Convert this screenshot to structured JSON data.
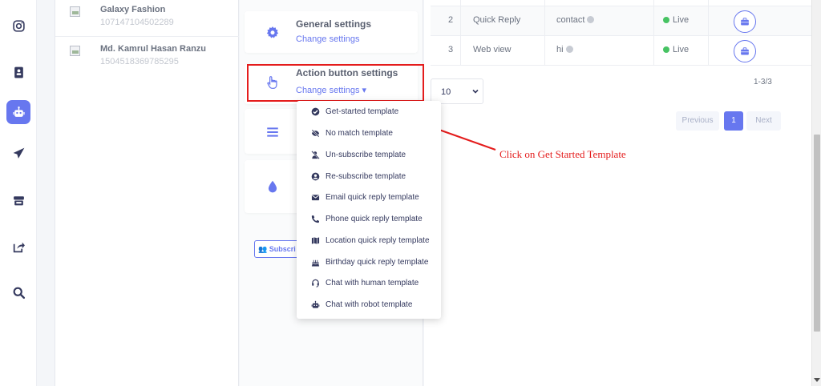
{
  "pages": [
    {
      "name": "Galaxy Fashion",
      "id": "107147104502289"
    },
    {
      "name": "Md. Kamrul Hasan Ranzu",
      "id": "1504518369785295"
    }
  ],
  "settings": {
    "general": {
      "title": "General settings",
      "link": "Change settings"
    },
    "action": {
      "title": "Action button settings",
      "link": "Change settings ▾"
    },
    "subscribers_button": "Subscri"
  },
  "menu": {
    "items": [
      {
        "label": "Get-started template",
        "icon": "check-circle-icon"
      },
      {
        "label": "No match template",
        "icon": "eye-slash-icon"
      },
      {
        "label": "Un-subscribe template",
        "icon": "user-slash-icon"
      },
      {
        "label": "Re-subscribe template",
        "icon": "user-circle-icon"
      },
      {
        "label": "Email quick reply template",
        "icon": "envelope-icon"
      },
      {
        "label": "Phone quick reply template",
        "icon": "phone-icon"
      },
      {
        "label": "Location quick reply template",
        "icon": "map-icon"
      },
      {
        "label": "Birthday quick reply template",
        "icon": "birthday-cake-icon"
      },
      {
        "label": "Chat with human template",
        "icon": "headset-icon"
      },
      {
        "label": "Chat with robot template",
        "icon": "robot-icon"
      }
    ]
  },
  "table": {
    "rows": [
      {
        "num": "2",
        "type": "Quick Reply",
        "keyword": "contact",
        "status": "Live"
      },
      {
        "num": "3",
        "type": "Web view",
        "keyword": "hi",
        "status": "Live"
      }
    ]
  },
  "pagination": {
    "per_page": "10",
    "count": "1-3/3",
    "previous": "Previous",
    "current": "1",
    "next": "Next"
  },
  "annotation": "Click on Get Started Template",
  "colors": {
    "accent": "#6777ef",
    "highlight": "#e41c1c",
    "live": "#47c363"
  }
}
